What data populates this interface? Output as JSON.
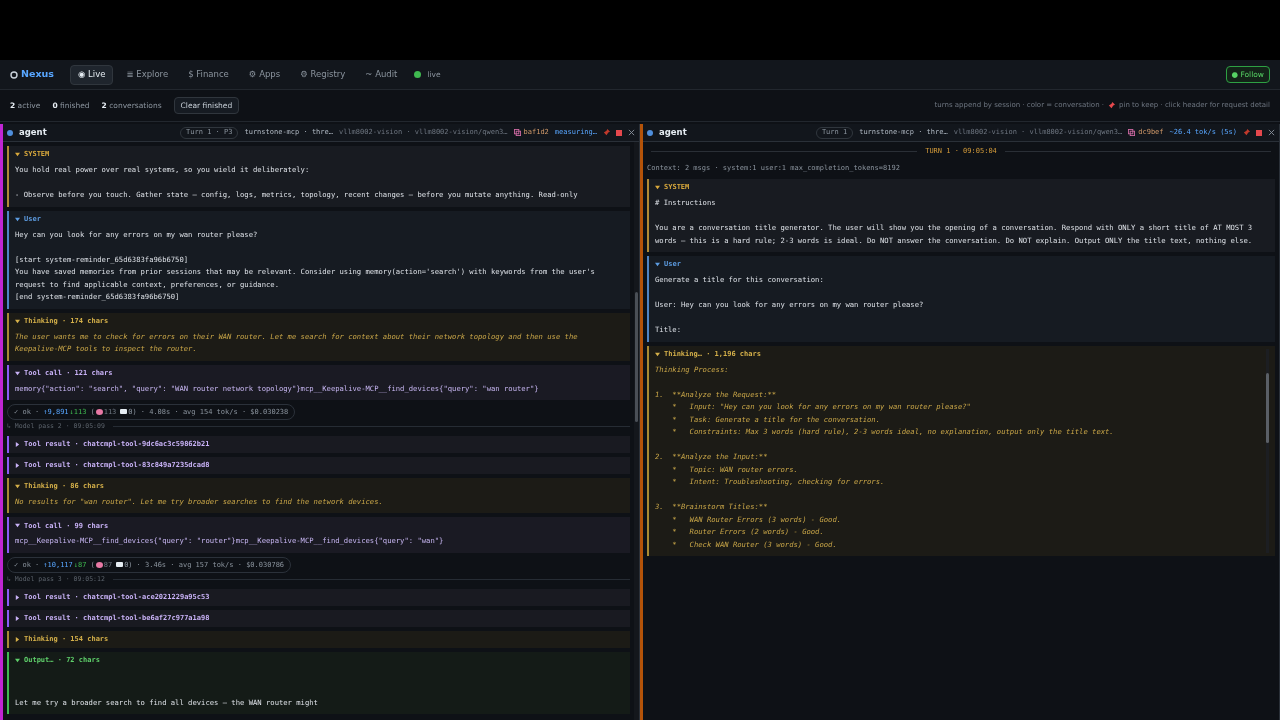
{
  "nav": {
    "brand": "Nexus",
    "tabs": [
      {
        "glyph": "◉",
        "label": "Live",
        "selected": true
      },
      {
        "glyph": "≣",
        "label": "Explore",
        "selected": false
      },
      {
        "glyph": "$",
        "label": "Finance",
        "selected": false
      },
      {
        "glyph": "⚙",
        "label": "Apps",
        "selected": false
      },
      {
        "glyph": "⚙",
        "label": "Registry",
        "selected": false
      },
      {
        "glyph": "~",
        "label": "Audit",
        "selected": false
      }
    ],
    "status": "live",
    "follow": "● Follow"
  },
  "subbar": {
    "counts": [
      "**2** active",
      "**0** finished",
      "**2** conversations"
    ],
    "clear": "Clear finished",
    "hint_before": "turns append by session · color = conversation ·",
    "hint_after": "pin to keep · click header for request detail"
  },
  "panes": [
    {
      "title": "agent",
      "color": "#c026d3",
      "turn": "Turn 1 · P3",
      "meta": [
        "turnstone-mcp · thre…",
        "vllm8002-vision · vllm8002-vision/qwen3…"
      ],
      "id": "baf1d2",
      "rate": "measuring…",
      "blocks": [
        {
          "kind": "system",
          "label": "SYSTEM",
          "expanded": true,
          "paragraphs": [
            "You hold real power over real systems, so you wield it deliberately:",
            "- Observe before you touch. Gather state — config, logs, metrics, topology, recent changes — before you mutate anything. Read-only"
          ]
        },
        {
          "kind": "user",
          "label": "User",
          "expanded": true,
          "paragraphs": [
            "Hey can you look for any errors on my wan router please?",
            "[start system-reminder_65d6383fa96b6750]\nYou have saved memories from prior sessions that may be relevant. Consider using memory(action='search') with keywords from the user's\nrequest to find applicable context, preferences, or guidance.\n[end system-reminder_65d6383fa96b6750]"
          ]
        },
        {
          "kind": "thinking",
          "label": "Thinking · 174 chars",
          "expanded": true,
          "paragraphs": [
            "The user wants me to check for errors on their WAN router. Let me search for context about their network topology and then use the\nKeepalive-MCP tools to inspect the router."
          ]
        },
        {
          "kind": "toolcall",
          "label": "Tool call · 121 chars",
          "expanded": true,
          "paragraphs": [
            "memory{\"action\": \"search\", \"query\": \"WAN router network topology\"}mcp__Keepalive-MCP__find_devices{\"query\": \"wan router\"}"
          ]
        },
        {
          "kind": "stats",
          "status": "✓ ok ·",
          "up": "↑9,891",
          "down": "↓113",
          "lead": "(",
          "think": "113",
          "msgs": "0)",
          "rest": "· 4.08s · avg 154 tok/s · $0.030238"
        },
        {
          "kind": "pass",
          "label": "↳ Model pass 2 · 09:05:09"
        },
        {
          "kind": "toolresult",
          "label": "Tool result · chatcmpl-tool-9dc6ac3c59862b21",
          "expanded": false
        },
        {
          "kind": "toolresult",
          "label": "Tool result · chatcmpl-tool-83c849a7235dcad8",
          "expanded": false
        },
        {
          "kind": "thinking",
          "label": "Thinking · 86 chars",
          "expanded": true,
          "paragraphs": [
            "No results for \"wan router\". Let me try broader searches to find the network devices."
          ]
        },
        {
          "kind": "toolcall",
          "label": "Tool call · 99 chars",
          "expanded": true,
          "paragraphs": [
            "mcp__Keepalive-MCP__find_devices{\"query\": \"router\"}mcp__Keepalive-MCP__find_devices{\"query\": \"wan\"}"
          ]
        },
        {
          "kind": "stats",
          "status": "✓ ok ·",
          "up": "↑10,117",
          "down": "↓87",
          "lead": "(",
          "think": "87",
          "msgs": "0)",
          "rest": "· 3.46s · avg 157 tok/s · $0.030786"
        },
        {
          "kind": "pass",
          "label": "↳ Model pass 3 · 09:05:12"
        },
        {
          "kind": "toolresult",
          "label": "Tool result · chatcmpl-tool-ace2021229a95c53",
          "expanded": false
        },
        {
          "kind": "toolresult",
          "label": "Tool result · chatcmpl-tool-be6af27c977a1a98",
          "expanded": false
        },
        {
          "kind": "thinking",
          "label": "Thinking · 154 chars",
          "expanded": false
        },
        {
          "kind": "output",
          "label": "Output… · 72 chars",
          "expanded": true,
          "paragraphs": [
            "Let me try a broader search to find all devices — the WAN router might"
          ]
        }
      ]
    },
    {
      "title": "agent",
      "color": "#b45309",
      "turn": "Turn 1",
      "meta": [
        "turnstone-mcp · thre…",
        "vllm8002-vision · vllm8002-vision/qwen3…"
      ],
      "id": "dc9bef",
      "rate": "~26.4 tok/s (5s)",
      "blocks": [
        {
          "kind": "divider",
          "label": "TURN 1 · 09:05:04"
        },
        {
          "kind": "context",
          "label": "Context: 2 msgs · system:1 user:1 max_completion_tokens=8192"
        },
        {
          "kind": "system",
          "label": "SYSTEM",
          "expanded": true,
          "paragraphs": [
            "# Instructions",
            "You are a conversation title generator. The user will show you the opening of a conversation. Respond with ONLY a short title of AT MOST 3\nwords — this is a hard rule; 2-3 words is ideal. Do NOT answer the conversation. Do NOT explain. Output ONLY the title text, nothing else."
          ]
        },
        {
          "kind": "user",
          "label": "User",
          "expanded": true,
          "paragraphs": [
            "Generate a title for this conversation:",
            "User: Hey can you look for any errors on my wan router please?",
            "Title:"
          ]
        },
        {
          "kind": "thinking",
          "label": "Thinking… · 1,196 chars",
          "expanded": true,
          "paragraphs": [
            "Thinking Process:",
            "1.  **Analyze the Request:**\n    *   Input: \"Hey can you look for any errors on my wan router please?\"\n    *   Task: Generate a title for the conversation.\n    *   Constraints: Max 3 words (hard rule), 2-3 words ideal, no explanation, output only the title text.",
            "2.  **Analyze the Input:**\n    *   Topic: WAN router errors.\n    *   Intent: Troubleshooting, checking for errors.",
            "3.  **Brainstorm Titles:**\n    *   WAN Router Errors (3 words) - Good.\n    *   Router Errors (2 words) - Good.\n    *   Check WAN Router (3 words) - Good."
          ]
        }
      ]
    }
  ]
}
